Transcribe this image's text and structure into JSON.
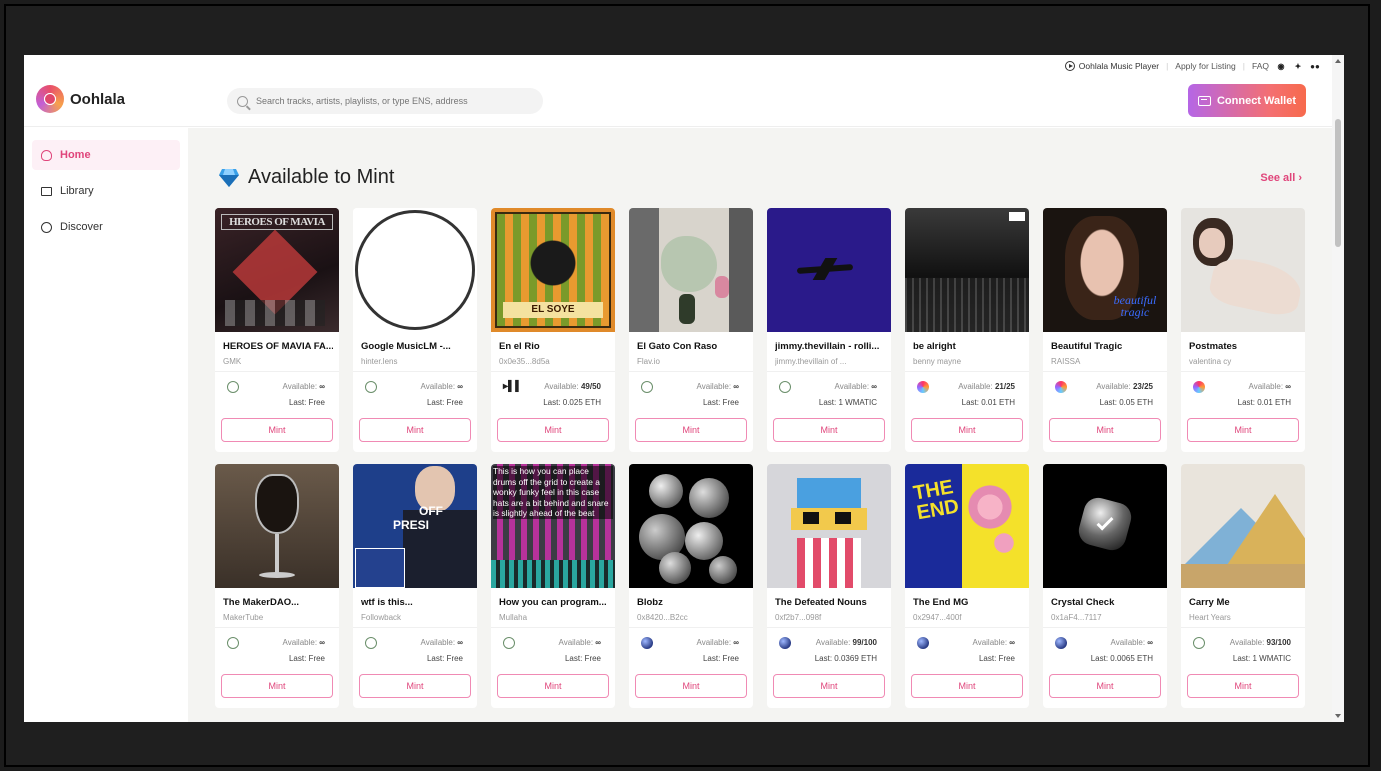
{
  "toplinks": {
    "player": "Oohlala Music Player",
    "apply": "Apply for Listing",
    "faq": "FAQ"
  },
  "brand": {
    "name": "Oohlala"
  },
  "search": {
    "placeholder": "Search tracks, artists, playlists, or type ENS, address"
  },
  "header": {
    "connect_label": "Connect Wallet"
  },
  "sidebar": {
    "items": [
      {
        "label": "Home",
        "icon": "home-icon",
        "active": true
      },
      {
        "label": "Library",
        "icon": "folder-icon",
        "active": false
      },
      {
        "label": "Discover",
        "icon": "compass-icon",
        "active": false
      }
    ]
  },
  "section": {
    "title": "Available to Mint",
    "see_all": "See all ›"
  },
  "cards": [
    {
      "title": "HEROES OF MAVIA FA...",
      "artist": "GMK",
      "chain": "matic",
      "available_label": "Available:",
      "available_value": "∞",
      "last": "Last: Free",
      "mint_label": "Mint"
    },
    {
      "title": "Google MusicLM -...",
      "artist": "hinter.lens",
      "chain": "matic",
      "available_label": "Available:",
      "available_value": "∞",
      "last": "Last: Free",
      "mint_label": "Mint"
    },
    {
      "title": "En el Rio",
      "artist": "0x0e35...8d5a",
      "chain": "sound",
      "available_label": "Available:",
      "available_value": "49/50",
      "last": "Last: 0.025 ETH",
      "mint_label": "Mint"
    },
    {
      "title": "El Gato Con Raso",
      "artist": "Flav.io",
      "chain": "matic",
      "available_label": "Available:",
      "available_value": "∞",
      "last": "Last: Free",
      "mint_label": "Mint"
    },
    {
      "title": "jimmy.thevillain - rolli...",
      "artist": "jimmy.thevillain of ...",
      "chain": "matic",
      "available_label": "Available:",
      "available_value": "∞",
      "last": "Last: 1 WMATIC",
      "mint_label": "Mint"
    },
    {
      "title": "be alright",
      "artist": "benny mayne",
      "chain": "rainbow",
      "available_label": "Available:",
      "available_value": "21/25",
      "last": "Last: 0.01 ETH",
      "mint_label": "Mint"
    },
    {
      "title": "Beautiful Tragic",
      "artist": "RAISSA",
      "chain": "rainbow",
      "available_label": "Available:",
      "available_value": "23/25",
      "last": "Last: 0.05 ETH",
      "mint_label": "Mint"
    },
    {
      "title": "Postmates",
      "artist": "valentina cy",
      "chain": "rainbow",
      "available_label": "Available:",
      "available_value": "∞",
      "last": "Last: 0.01 ETH",
      "mint_label": "Mint"
    },
    {
      "title": "The MakerDAO...",
      "artist": "MakerTube",
      "chain": "matic",
      "available_label": "Available:",
      "available_value": "∞",
      "last": "Last: Free",
      "mint_label": "Mint"
    },
    {
      "title": "wtf is this...",
      "artist": "Followback",
      "chain": "matic",
      "available_label": "Available:",
      "available_value": "∞",
      "last": "Last: Free",
      "mint_label": "Mint"
    },
    {
      "title": "How you can program...",
      "artist": "Mullaha",
      "chain": "matic",
      "available_label": "Available:",
      "available_value": "∞",
      "last": "Last: Free",
      "mint_label": "Mint"
    },
    {
      "title": "Blobz",
      "artist": "0x8420...B2cc",
      "chain": "eth",
      "available_label": "Available:",
      "available_value": "∞",
      "last": "Last: Free",
      "mint_label": "Mint"
    },
    {
      "title": "The Defeated Nouns",
      "artist": "0xf2b7...098f",
      "chain": "eth",
      "available_label": "Available:",
      "available_value": "99/100",
      "last": "Last: 0.0369 ETH",
      "mint_label": "Mint"
    },
    {
      "title": "The End MG",
      "artist": "0x2947...400f",
      "chain": "eth",
      "available_label": "Available:",
      "available_value": "∞",
      "last": "Last: Free",
      "mint_label": "Mint"
    },
    {
      "title": "Crystal Check",
      "artist": "0x1aF4...7117",
      "chain": "eth",
      "available_label": "Available:",
      "available_value": "∞",
      "last": "Last: 0.0065 ETH",
      "mint_label": "Mint"
    },
    {
      "title": "Carry Me",
      "artist": "Heart Years",
      "chain": "matic",
      "available_label": "Available:",
      "available_value": "93/100",
      "last": "Last: 1 WMATIC",
      "mint_label": "Mint"
    }
  ],
  "art_text": {
    "heroes": "HEROES OF MAVIA",
    "elsoye": "EL SOYE",
    "program": "This is how you can place drums off the grid to create a wonky funky feel in this case hats are a bit behind and snare is slightly ahead of the beat",
    "end_a": "THE",
    "end_b": "END",
    "beautiful": "beautiful tragic",
    "office": "OFF",
    "presi": "PRESI"
  },
  "colors": {
    "accent": "#e0457b",
    "mint_border": "#f08ab4"
  }
}
